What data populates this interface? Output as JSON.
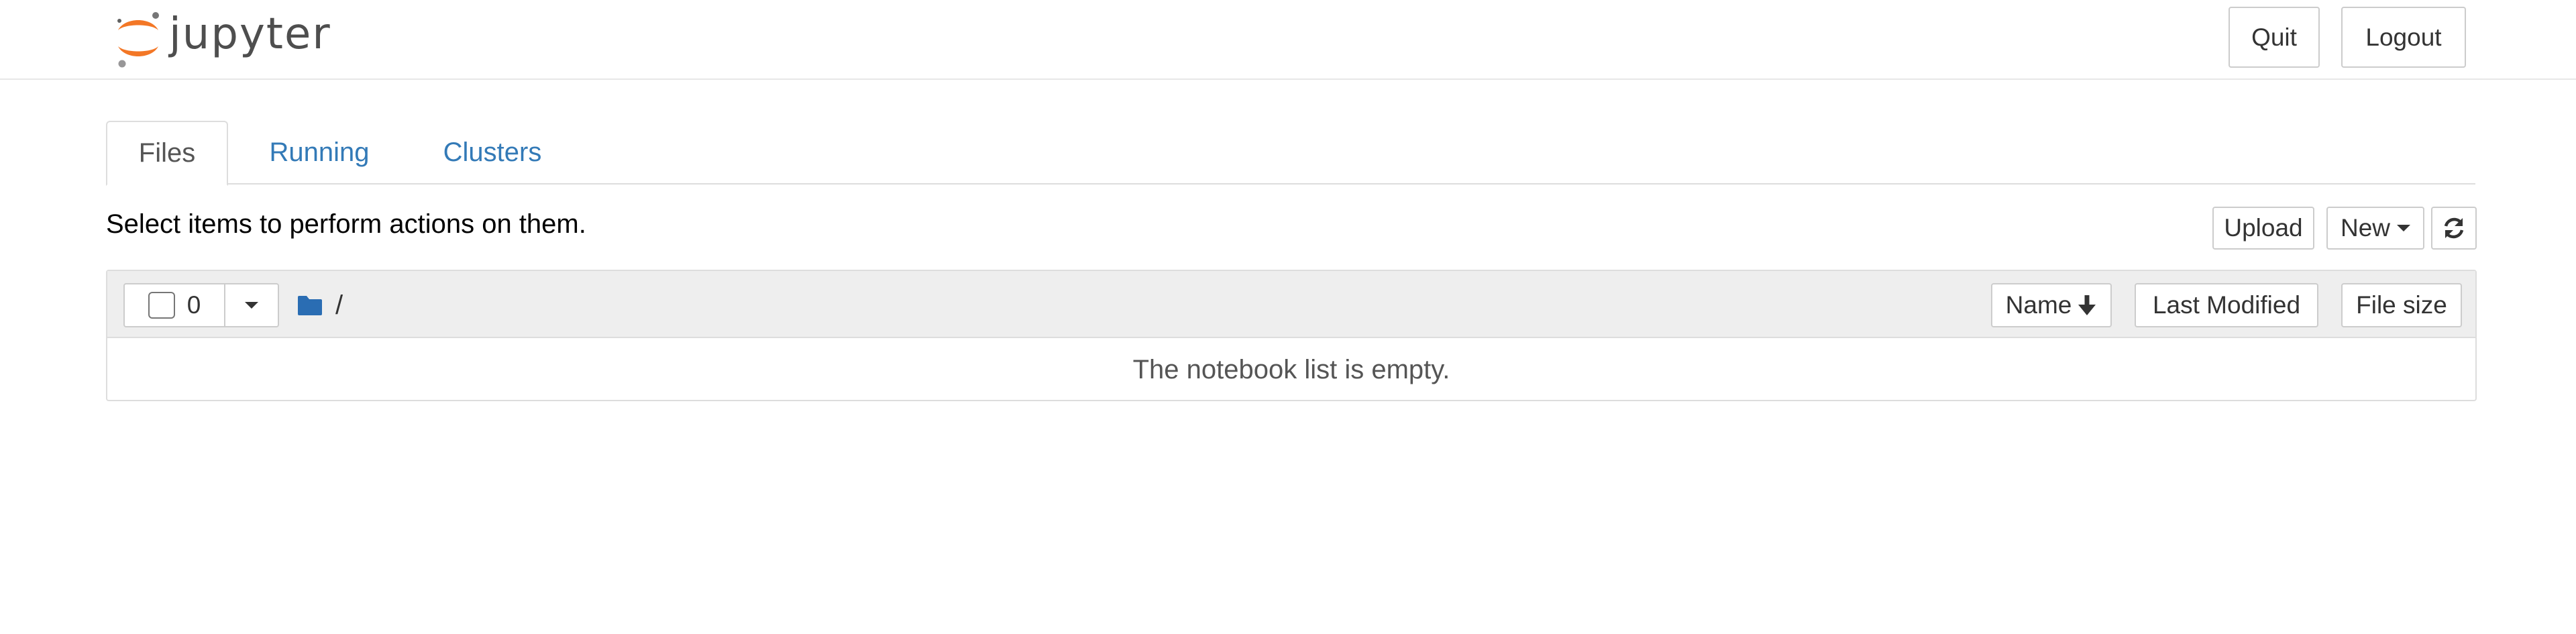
{
  "header": {
    "logo_text": "jupyter",
    "quit_label": "Quit",
    "logout_label": "Logout"
  },
  "tabs": [
    {
      "label": "Files",
      "active": true
    },
    {
      "label": "Running",
      "active": false
    },
    {
      "label": "Clusters",
      "active": false
    }
  ],
  "toolbar": {
    "hint": "Select items to perform actions on them.",
    "upload_label": "Upload",
    "new_label": "New",
    "refresh_icon": "refresh-icon"
  },
  "file_list": {
    "selected_count": "0",
    "breadcrumb_root": "/",
    "columns": {
      "name": "Name",
      "last_modified": "Last Modified",
      "file_size": "File size"
    },
    "empty_message": "The notebook list is empty."
  },
  "colors": {
    "link": "#337ab7",
    "logo_orange": "#f37726",
    "logo_gray": "#767677",
    "folder_blue": "#2a6db3",
    "panel_header": "#eeeeee"
  }
}
